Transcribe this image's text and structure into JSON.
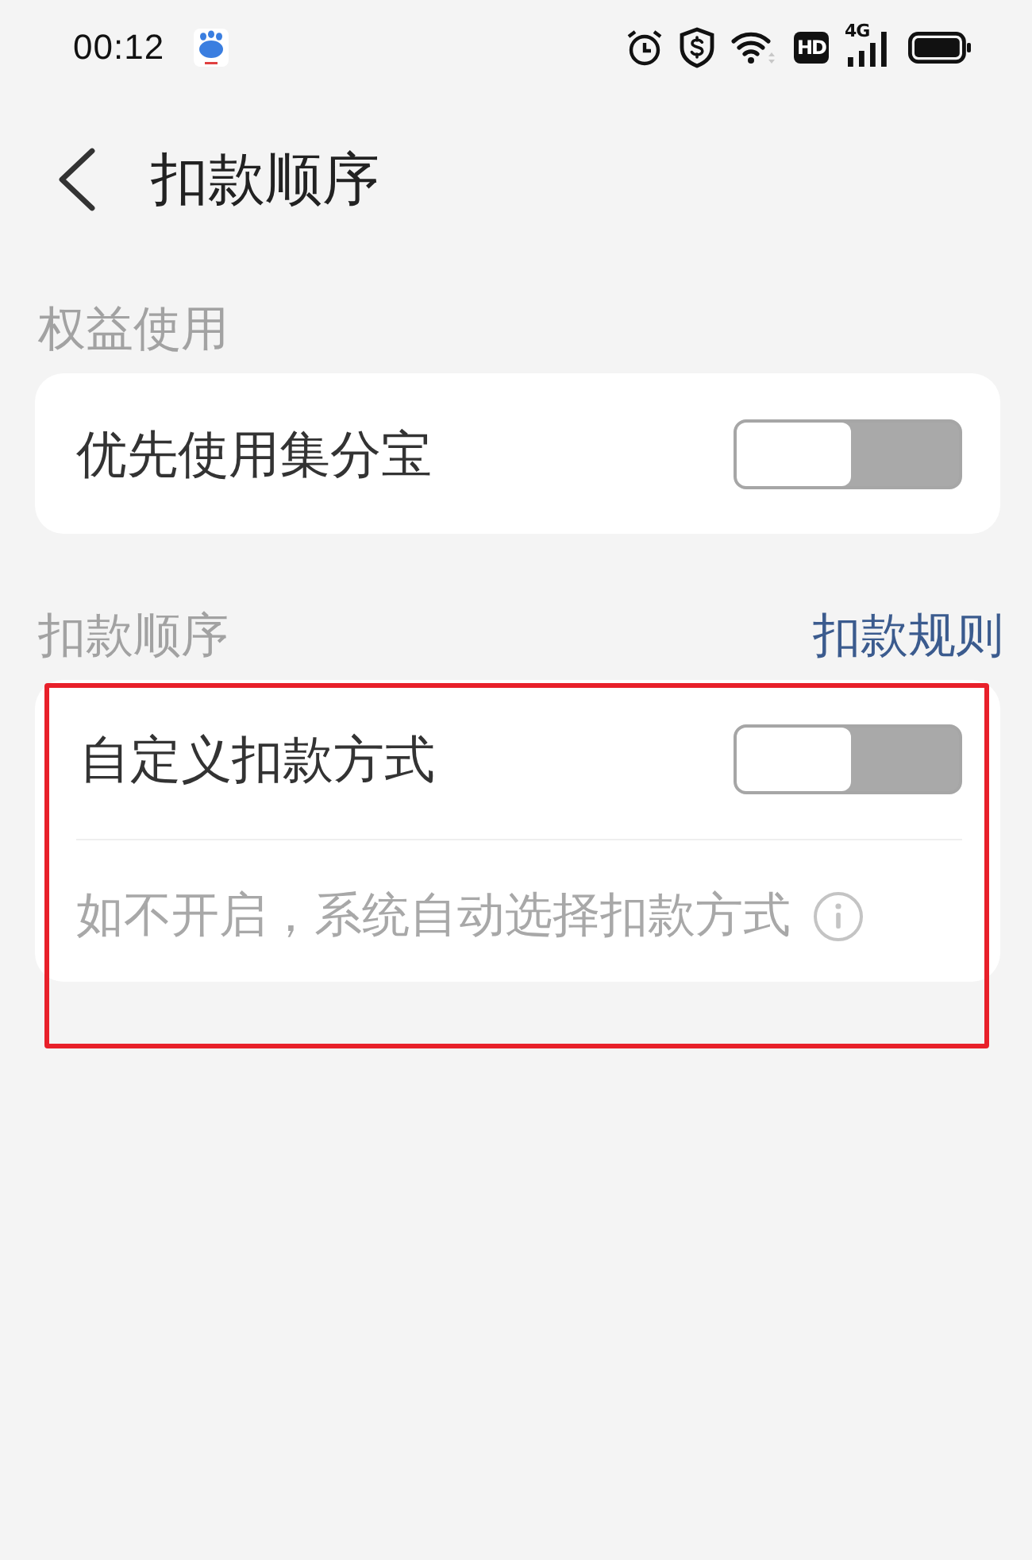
{
  "status_bar": {
    "time": "00:12",
    "hd_badge": "HD",
    "network_type": "4G"
  },
  "header": {
    "title": "扣款顺序"
  },
  "sections": [
    {
      "label": "权益使用",
      "highlighted": false,
      "rows": [
        {
          "kind": "toggle",
          "label": "优先使用集分宝",
          "checked": false
        }
      ]
    },
    {
      "label": "扣款顺序",
      "link": "扣款规则",
      "highlighted": true,
      "rows": [
        {
          "kind": "toggle",
          "label": "自定义扣款方式",
          "checked": false
        },
        {
          "kind": "hint",
          "text": "如不开启，系统自动选择扣款方式"
        }
      ]
    }
  ]
}
